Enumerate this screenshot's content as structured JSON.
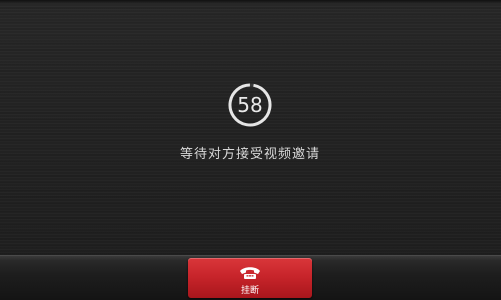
{
  "call": {
    "countdown_seconds": "58",
    "countdown_progress": 0.97,
    "status_text": "等待对方接受视频邀请"
  },
  "actions": {
    "hangup_label": "挂断",
    "hangup_icon": "phone-hangup-icon"
  },
  "colors": {
    "background": "#222222",
    "hangup_button": "#c8252b",
    "text": "#d8d8d8"
  }
}
